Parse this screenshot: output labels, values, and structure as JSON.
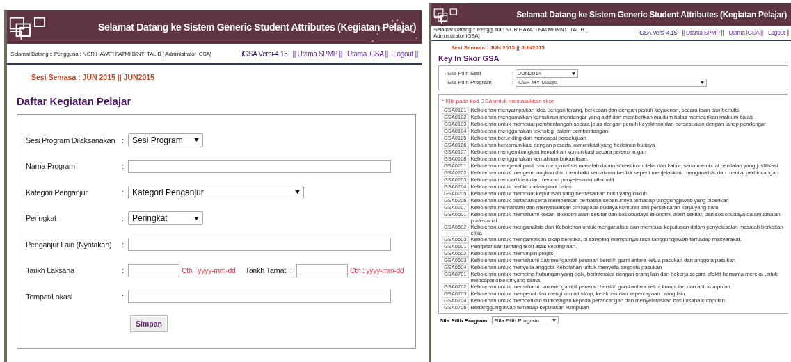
{
  "activity_screen": {
    "banner_title": "Selamat Datang ke Sistem Generic Student Attributes (Kegiatan Pelajar)",
    "user_info": "Selamat Datang :: Pengguna : NOR HAYATI FATMI BINTI TALIB [ Administrator iGSA]",
    "nav": [
      {
        "label": "iGSA Versi-4.15",
        "kind": "version"
      },
      {
        "label": "|| Utama SPMP ||",
        "kind": "link"
      },
      {
        "label": "Utama iGSA ||",
        "kind": "link"
      },
      {
        "label": "Logout ||",
        "kind": "link"
      }
    ],
    "session": "Sesi Semasa : JUN 2015 || JUN2015",
    "page_title": "Daftar Kegiatan Pelajar",
    "fields": [
      {
        "label": "Sesi Program Dilaksanakan",
        "separator": ":",
        "kind": "select",
        "value": "Sesi Program"
      },
      {
        "label": "Nama Program",
        "separator": ":",
        "kind": "text"
      },
      {
        "label": "Kategori Penganjur",
        "separator": ":",
        "kind": "wide_select",
        "value": "Kategori Penganjur"
      },
      {
        "label": "Peringkat",
        "separator": ":",
        "kind": "select",
        "value": "Peringkat"
      },
      {
        "label": "Penganjur Lain (Nyatakan)",
        "separator": ":",
        "kind": "text"
      },
      {
        "label": "Tarikh Laksana",
        "separator": ":",
        "kind": "date_pair",
        "hint": "Cth : yyyy-mm-dd",
        "label_2": "Tarikh Tamat",
        "separator_2": ":",
        "hint_2": "Cth : yyyy-mm-dd"
      },
      {
        "label": "Tempat/Lokasi",
        "separator": ":",
        "kind": "text"
      }
    ],
    "save_button": "Simpan"
  },
  "score_screen": {
    "banner_title": "Selamat Datang ke Sistem Generic Student Attributes (Kegiatan Pelajar)",
    "user_info": "Selamat Datang :: Pengguna : NOR HAYATI FATMI BINTI TALIB [ Administrator iGSA]",
    "nav": [
      {
        "label": "iGSA Versi-4.15",
        "kind": "version"
      },
      {
        "label": "|| Utama SPMP ||",
        "kind": "link"
      },
      {
        "label": "Utama iGSA ||",
        "kind": "link"
      },
      {
        "label": "Logout ||",
        "kind": "link"
      }
    ],
    "session": "Sesi Semasa : JUN 2015 || JUN2015",
    "page_title": "Key In Skor GSA",
    "selects": [
      {
        "label": "Sila Pilih Sesi",
        "separator": ":",
        "value": "JUN2014",
        "kind": "short"
      },
      {
        "label": "Sila Pilih Program",
        "separator": ":",
        "value": "CSR MY Masjid",
        "kind": "wide"
      }
    ],
    "note": "* Klik pada kod GSA untuk memasukkan skor",
    "items": [
      {
        "code": "GSA0101",
        "text": "Kebolehan menyampaikan idea dengan terang, berkesan dan dengan penuh keyakinan, secara lisan dan bertulis."
      },
      {
        "code": "GSA0102",
        "text": "Kebolehan mengamalkan kemahiran mendengar yang aktif dan memberikan maklum balas memberikan maklum balas."
      },
      {
        "code": "GSA0103",
        "text": "Kebolehan untuk membuat pembentangan secara jelas dengan penuh keyakinan dan bersesuaian dengan tahap pendengar"
      },
      {
        "code": "GSA0104",
        "text": "Kebolehan menggunakan teknologi dalam pembentangan"
      },
      {
        "code": "GSA0105",
        "text": "Kebolehan berunding dan mencapai persetujuan"
      },
      {
        "code": "GSA0106",
        "text": "Kebolehan berkomunikasi dengan peserta komunikasi yang berlainan budaya"
      },
      {
        "code": "GSA0107",
        "text": "Kebolehan mengembangkan kemahiran komunikasi secara perseorangan"
      },
      {
        "code": "GSA0108",
        "text": "Kebolehan menggunakan kemahiran bukan lisan."
      },
      {
        "code": "GSA0201",
        "text": "Kebolehan mengenal pasti dan menganalisis masalah dalam situasi kompleks dan kabur, serta membuat penilaian yang justifikasi"
      },
      {
        "code": "GSA0202",
        "text": "Kebolehan untuk mengembangkan dan membaiki kemahiran berfikir seperti menjelaskan, menganalisis dan menilai perbincangan."
      },
      {
        "code": "GSA0203",
        "text": "Kebolehan mencari idea dan mencari penyelesaian alternatif"
      },
      {
        "code": "GSA0204",
        "text": "Kebolehan untuk berfikir melangkaui batas"
      },
      {
        "code": "GSA0205",
        "text": "Kebolehan untuk membuat keputusan yang berdasarkan bukti yang kukuh"
      },
      {
        "code": "GSA0206",
        "text": "Kebolehan untuk bertahan serta memberikan perhatian sepenuhnya terhadap tanggungjawab yang diberikan"
      },
      {
        "code": "GSA0207",
        "text": "Kebolehan memahami dan menyesuaikan diri kepada budaya komuniti dan persekitaran kerja yang baru"
      },
      {
        "code": "GSA0501",
        "text": "Kebolehan untuk memahami kesan ekonomi alam sekitar dan sosiobudaya ekonomi, alam sekitar, dan sosiobudaya dalam amalan profesional"
      },
      {
        "code": "GSA0502",
        "text": "Kebolehan untuk menganalisis dan Kebolehan untuk menganalisis dan membuat keputusan dalam penyelesaian masalah berkaitan etika"
      },
      {
        "code": "GSA0503",
        "text": "Kebolehan untuk mengamalkan sikap beretika, di samping mempunyai rasa tanggungjawab terhadap masyarakat."
      },
      {
        "code": "GSA0601",
        "text": "Pengetahuan tentang teori asas kepimpinan."
      },
      {
        "code": "GSA0602",
        "text": "Kebolehan untuk memimpin projek"
      },
      {
        "code": "GSA0603",
        "text": "Kebolehan untuk memahami dan mengambil peranan bersilih ganti antara ketua pasukan dan anggota pasukan"
      },
      {
        "code": "GSA0604",
        "text": "Kebolehan untuk menyelia anggota Kebolehan untuk menyelia anggota pasukan"
      },
      {
        "code": "GSA0701",
        "text": "Kebolehan untuk membina hubungan yang baik, berinteraksi dengan orang lain dan bekerja secara efektif bersama mereka untuk mencapai objektif yang sama."
      },
      {
        "code": "GSA0702",
        "text": "Kebolehan untuk memahami dan mengambil peranan bersilih ganti antara ketua kumpulan dan ahli kumpulan."
      },
      {
        "code": "GSA0703",
        "text": "Kebolehan untuk mengenal dan menghormati sikap, kelakuan dan kepercayaan orang lain."
      },
      {
        "code": "GSA0704",
        "text": "Kebolehan untuk memberikan sumbangan kepada perancangan dan menyelaraskan hasil usaha kumpulan"
      },
      {
        "code": "GSA0705",
        "text": "Bertanggungjawab terhadap keputusan kumpulan"
      }
    ],
    "bottom_select": {
      "label": "Sila Pilih Program :",
      "value": "Sila Pilih Program"
    }
  }
}
